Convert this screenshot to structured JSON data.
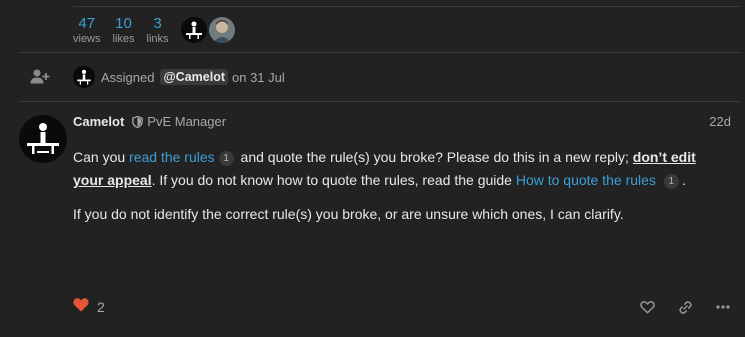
{
  "topic_stats": {
    "views": {
      "count": "47",
      "label": "views"
    },
    "likes": {
      "count": "10",
      "label": "likes"
    },
    "links": {
      "count": "3",
      "label": "links"
    }
  },
  "small_action": {
    "text": "Assigned",
    "mention": "@Camelot",
    "date": "on 31 Jul"
  },
  "post": {
    "username": "Camelot",
    "user_title": "PvE Manager",
    "date": "22d",
    "p1_a": "Can you",
    "p1_link1": "read the rules",
    "p1_link1_count": "1",
    "p1_b": "and quote the rule(s) you broke? Please do this in a new reply;",
    "p1_strong": "don’t edit your appeal",
    "p1_c": ". If you do not know how to quote the rules, read the guide",
    "p1_link2": "How to quote the rules",
    "p1_link2_count": "1",
    "p1_d": ".",
    "p2": "If you do not identify the correct rule(s) you broke, or are unsure which ones, I can clarify.",
    "like_count": "2"
  },
  "colors": {
    "background": "#222222",
    "link": "#3d9fd6",
    "liked_heart": "#e45735",
    "muted": "#a8a8a8"
  },
  "icons": [
    "user-plus-icon",
    "shield-icon",
    "heart-icon",
    "heart-outline-icon",
    "link-icon",
    "ellipsis-icon"
  ]
}
